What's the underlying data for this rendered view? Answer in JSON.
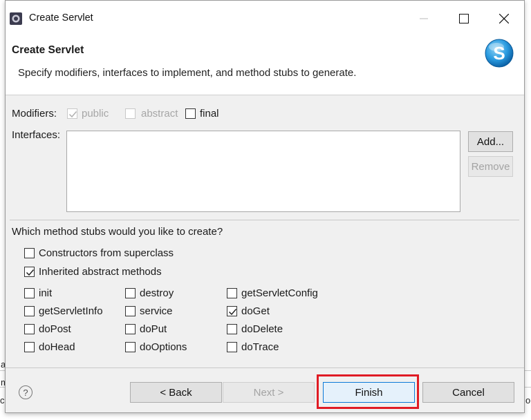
{
  "window": {
    "title": "Create Servlet",
    "controls": [
      "minimize-icon",
      "maximize-icon",
      "close-icon"
    ]
  },
  "header": {
    "title": "Create Servlet",
    "description": "Specify modifiers, interfaces to implement, and method stubs to generate.",
    "logo_icon": "servlet-wizard-logo-icon"
  },
  "modifiers": {
    "label": "Modifiers:",
    "public": {
      "label": "public",
      "checked": true,
      "enabled": false
    },
    "abstract": {
      "label": "abstract",
      "checked": false,
      "enabled": false
    },
    "final": {
      "label": "final",
      "checked": false,
      "enabled": true
    }
  },
  "interfaces": {
    "label": "Interfaces:",
    "items": [],
    "add_label": "Add...",
    "remove_label": "Remove"
  },
  "stubs": {
    "question": "Which method stubs would you like to create?",
    "constructors": {
      "label": "Constructors from superclass",
      "checked": false
    },
    "inherited": {
      "label": "Inherited abstract methods",
      "checked": true
    },
    "methods": [
      {
        "label": "init",
        "checked": false
      },
      {
        "label": "destroy",
        "checked": false
      },
      {
        "label": "getServletConfig",
        "checked": false
      },
      {
        "label": "getServletInfo",
        "checked": false
      },
      {
        "label": "service",
        "checked": false
      },
      {
        "label": "doGet",
        "checked": true
      },
      {
        "label": "doPost",
        "checked": false
      },
      {
        "label": "doPut",
        "checked": false
      },
      {
        "label": "doDelete",
        "checked": false
      },
      {
        "label": "doHead",
        "checked": false
      },
      {
        "label": "doOptions",
        "checked": false
      },
      {
        "label": "doTrace",
        "checked": false
      }
    ]
  },
  "footer": {
    "help_symbol": "?",
    "back_label": "< Back",
    "next_label": "Next >",
    "finish_label": "Finish",
    "cancel_label": "Cancel"
  },
  "background": {
    "fragments": [
      "a",
      "m",
      "cr",
      "o"
    ]
  },
  "colors": {
    "accent": "#0a78d7",
    "highlight": "#e01b24",
    "dialog_bg": "#f0f0f0"
  }
}
